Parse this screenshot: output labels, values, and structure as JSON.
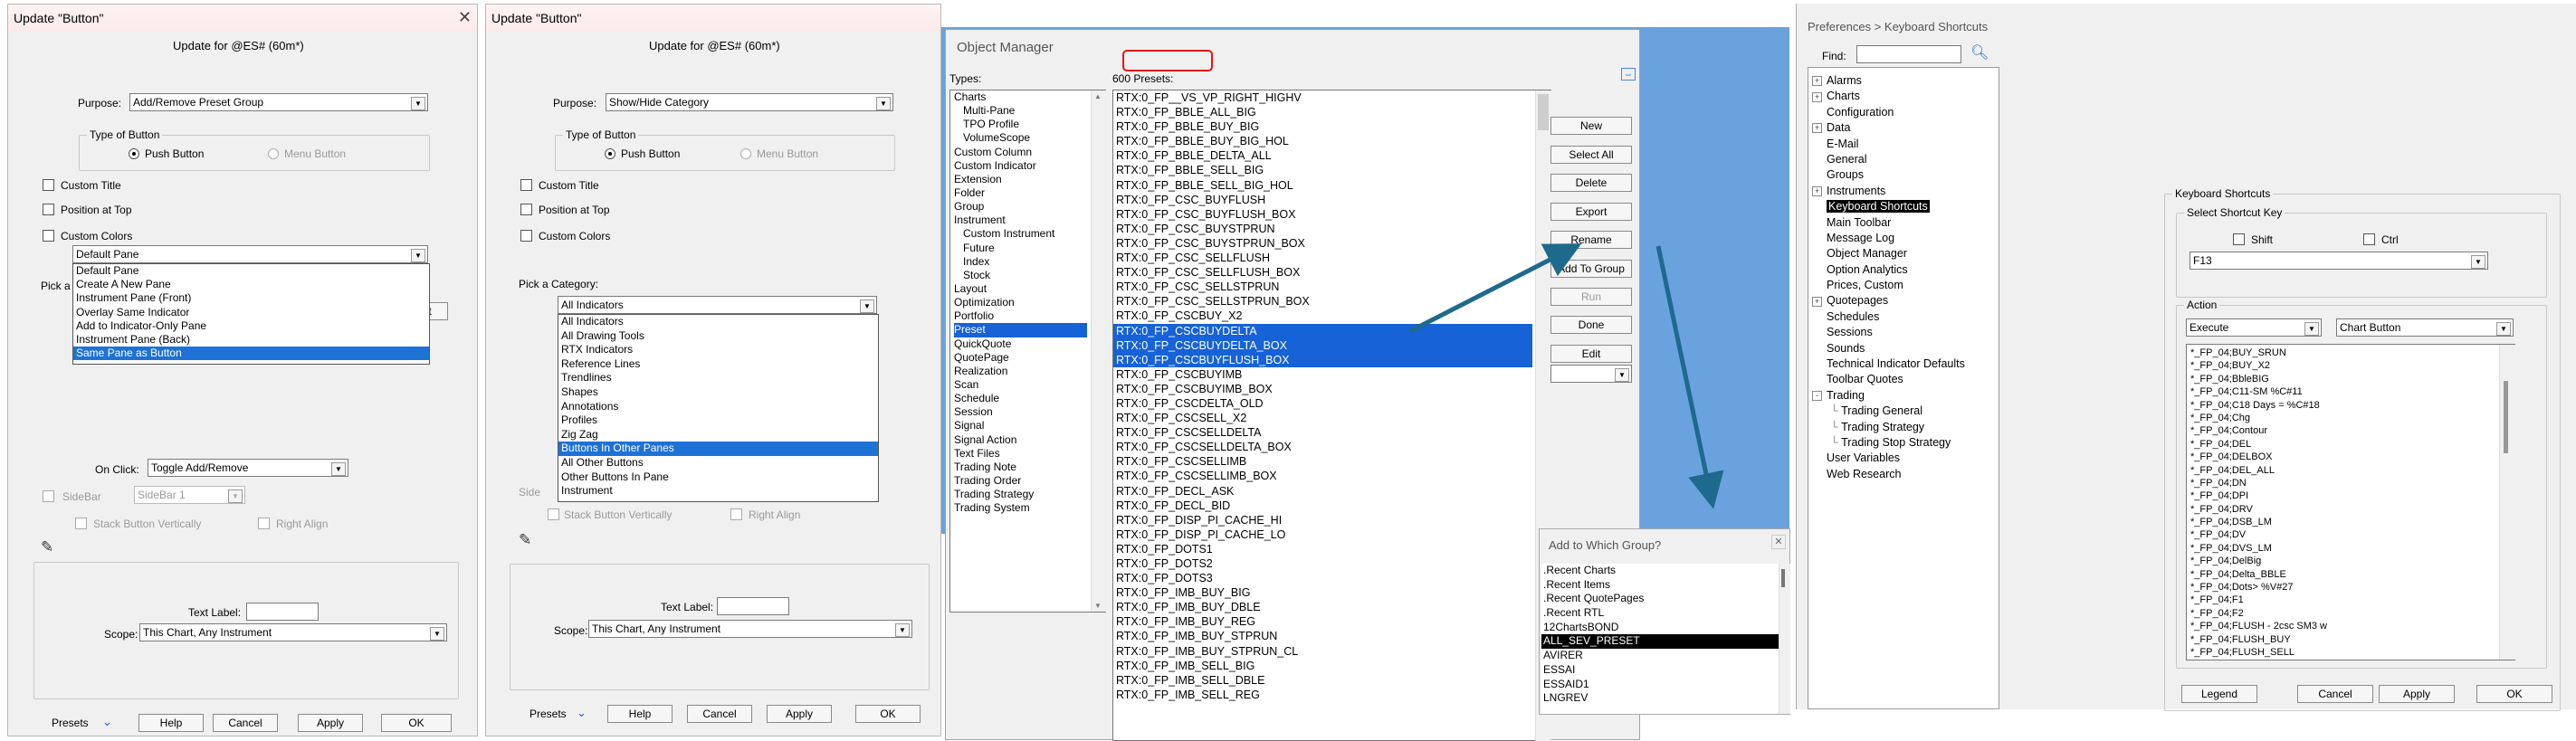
{
  "panel1": {
    "title": "Update \"Button\"",
    "subtitle": "Update  for @ES# (60m*)",
    "purpose_label": "Purpose:",
    "purpose_value": "Add/Remove Preset Group",
    "type_group_label": "Type of Button",
    "push_button": "Push Button",
    "menu_button": "Menu Button",
    "custom_title": "Custom Title",
    "position_top": "Position at Top",
    "custom_colors": "Custom Colors",
    "pane_combo_value": "Default Pane",
    "pick_a_partial": "Pick a",
    "pane_options": [
      "Default Pane",
      "Create A New Pane",
      "Instrument Pane (Front)",
      "Overlay Same Indicator",
      "Add to Indicator-Only Pane",
      "Instrument Pane (Back)",
      "Same Pane as Button"
    ],
    "pane_selected_index": 6,
    "on_click_label": "On Click:",
    "on_click_value": "Toggle Add/Remove",
    "sidebar_label": "SideBar",
    "sidebar_value": "SideBar 1",
    "stack_vertically": "Stack Button Vertically",
    "right_align": "Right Align",
    "text_label": "Text Label:",
    "scope_label": "Scope:",
    "scope_value": "This Chart, Any Instrument",
    "presets": "Presets",
    "help": "Help",
    "cancel": "Cancel",
    "apply": "Apply",
    "ok": "OK"
  },
  "panel2": {
    "title": "Update \"Button\"",
    "subtitle": "Update  for @ES# (60m*)",
    "purpose_label": "Purpose:",
    "purpose_value": "Show/Hide Category",
    "type_group_label": "Type of Button",
    "push_button": "Push Button",
    "menu_button": "Menu Button",
    "custom_title": "Custom Title",
    "position_top": "Position at Top",
    "custom_colors": "Custom Colors",
    "pick_category": "Pick a Category:",
    "category_value": "All Indicators",
    "category_options": [
      "All Indicators",
      "All Drawing Tools",
      "RTX Indicators",
      "Reference Lines",
      "Trendlines",
      "Shapes",
      "Annotations",
      "Profiles",
      "Zig Zag",
      "Buttons In Other Panes",
      "All Other Buttons",
      "Other Buttons In Pane",
      "Instrument"
    ],
    "category_selected_index": 9,
    "side_partial": "Side",
    "stack_vertically": "Stack Button Vertically",
    "right_align": "Right Align",
    "text_label": "Text Label:",
    "scope_label": "Scope:",
    "scope_value": "This Chart, Any Instrument",
    "presets": "Presets",
    "help": "Help",
    "cancel": "Cancel",
    "apply": "Apply",
    "ok": "OK"
  },
  "object_manager": {
    "title": "Object Manager",
    "types_label": "Types:",
    "presets_count": "600 Presets:",
    "types": [
      "Charts",
      "  Multi-Pane",
      "  TPO Profile",
      "  VolumeScope",
      "Custom Column",
      "Custom Indicator",
      "Extension",
      "Folder",
      "Group",
      "Instrument",
      "  Custom Instrument",
      "  Future",
      "  Index",
      "  Stock",
      "Layout",
      "Optimization",
      "Portfolio",
      "Preset",
      "QuickQuote",
      "QuotePage",
      "Realization",
      "Scan",
      "Schedule",
      "Session",
      "Signal",
      "Signal Action",
      "Text Files",
      "Trading Note",
      "Trading Order",
      "Trading Strategy",
      "Trading System"
    ],
    "types_selected_index": 17,
    "presets": [
      "RTX:0_FP__VS_VP_RIGHT_HIGHV",
      "RTX:0_FP_BBLE_ALL_BIG",
      "RTX:0_FP_BBLE_BUY_BIG",
      "RTX:0_FP_BBLE_BUY_BIG_HOL",
      "RTX:0_FP_BBLE_DELTA_ALL",
      "RTX:0_FP_BBLE_SELL_BIG",
      "RTX:0_FP_BBLE_SELL_BIG_HOL",
      "RTX:0_FP_CSC_BUYFLUSH",
      "RTX:0_FP_CSC_BUYFLUSH_BOX",
      "RTX:0_FP_CSC_BUYSTPRUN",
      "RTX:0_FP_CSC_BUYSTPRUN_BOX",
      "RTX:0_FP_CSC_SELLFLUSH",
      "RTX:0_FP_CSC_SELLFLUSH_BOX",
      "RTX:0_FP_CSC_SELLSTPRUN",
      "RTX:0_FP_CSC_SELLSTPRUN_BOX",
      "RTX:0_FP_CSCBUY_X2",
      "RTX:0_FP_CSCBUYDELTA",
      "RTX:0_FP_CSCBUYDELTA_BOX",
      "RTX:0_FP_CSCBUYFLUSH_BOX",
      "RTX:0_FP_CSCBUYIMB",
      "RTX:0_FP_CSCBUYIMB_BOX",
      "RTX:0_FP_CSCDELTA_OLD",
      "RTX:0_FP_CSCSELL_X2",
      "RTX:0_FP_CSCSELLDELTA",
      "RTX:0_FP_CSCSELLDELTA_BOX",
      "RTX:0_FP_CSCSELLIMB",
      "RTX:0_FP_CSCSELLIMB_BOX",
      "RTX:0_FP_DECL_ASK",
      "RTX:0_FP_DECL_BID",
      "RTX:0_FP_DISP_PI_CACHE_HI",
      "RTX:0_FP_DISP_PI_CACHE_LO",
      "RTX:0_FP_DOTS1",
      "RTX:0_FP_DOTS2",
      "RTX:0_FP_DOTS3",
      "RTX:0_FP_IMB_BUY_BIG",
      "RTX:0_FP_IMB_BUY_DBLE",
      "RTX:0_FP_IMB_BUY_REG",
      "RTX:0_FP_IMB_BUY_STPRUN",
      "RTX:0_FP_IMB_BUY_STPRUN_CL",
      "RTX:0_FP_IMB_SELL_BIG",
      "RTX:0_FP_IMB_SELL_DBLE",
      "RTX:0_FP_IMB_SELL_REG"
    ],
    "presets_selected": [
      16,
      17,
      18
    ],
    "buttons": [
      "New",
      "Select All",
      "Delete",
      "Export",
      "Rename",
      "Add To Group",
      "Run",
      "Done",
      "Edit"
    ],
    "add_group_title": "Add to Which Group?",
    "groups": [
      ".Recent Charts",
      ".Recent Items",
      ".Recent QuotePages",
      ".Recent RTL",
      "12ChartsBOND",
      "ALL_SEV_PRESET",
      "AVIRER",
      "ESSAI",
      "ESSAID1",
      "LNGREV"
    ],
    "groups_selected_index": 5,
    "accent_arrow": "#1e6a8c",
    "blue_bg": "#6aa2de"
  },
  "preferences": {
    "title": "Preferences > Keyboard Shortcuts",
    "find_label": "Find:",
    "tree": [
      {
        "label": "Alarms",
        "exp": "+"
      },
      {
        "label": "Charts",
        "exp": "+"
      },
      {
        "label": "Configuration",
        "exp": ""
      },
      {
        "label": "Data",
        "exp": "+"
      },
      {
        "label": "E-Mail",
        "exp": ""
      },
      {
        "label": "General",
        "exp": ""
      },
      {
        "label": "Groups",
        "exp": ""
      },
      {
        "label": "Instruments",
        "exp": "+"
      },
      {
        "label": "Keyboard Shortcuts",
        "exp": "",
        "sel": true
      },
      {
        "label": "Main Toolbar",
        "exp": ""
      },
      {
        "label": "Message Log",
        "exp": ""
      },
      {
        "label": "Object Manager",
        "exp": ""
      },
      {
        "label": "Option Analytics",
        "exp": ""
      },
      {
        "label": "Prices, Custom",
        "exp": ""
      },
      {
        "label": "Quotepages",
        "exp": "+"
      },
      {
        "label": "Schedules",
        "exp": ""
      },
      {
        "label": "Sessions",
        "exp": ""
      },
      {
        "label": "Sounds",
        "exp": ""
      },
      {
        "label": "Technical Indicator Defaults",
        "exp": ""
      },
      {
        "label": "Toolbar Quotes",
        "exp": ""
      },
      {
        "label": "Trading",
        "exp": "-"
      },
      {
        "label": "Trading General",
        "exp": "",
        "child": true
      },
      {
        "label": "Trading Strategy",
        "exp": "",
        "child": true
      },
      {
        "label": "Trading Stop Strategy",
        "exp": "",
        "child": true
      },
      {
        "label": "User Variables",
        "exp": ""
      },
      {
        "label": "Web Research",
        "exp": ""
      }
    ],
    "ks_group": "Keyboard Shortcuts",
    "select_key_group": "Select Shortcut Key",
    "shift": "Shift",
    "ctrl": "Ctrl",
    "key_value": "F13",
    "action_group": "Action",
    "action_value": "Execute",
    "target_value": "Chart Button",
    "actions": [
      "*_FP_04;BUY_SRUN",
      "*_FP_04;BUY_X2",
      "*_FP_04;BbleBIG",
      "*_FP_04;C11-SM %C#11",
      "*_FP_04;C18 Days = %C#18",
      "*_FP_04;Chg",
      "*_FP_04;Contour",
      "*_FP_04;DEL",
      "*_FP_04;DELBOX",
      "*_FP_04;DEL_ALL",
      "*_FP_04;DN",
      "*_FP_04;DPI",
      "*_FP_04;DRV",
      "*_FP_04;DSB_LM",
      "*_FP_04;DV",
      "*_FP_04;DVS_LM",
      "*_FP_04;DelBig",
      "*_FP_04;Delta_BBLE",
      "*_FP_04;Dots> %V#27",
      "*_FP_04;F1",
      "*_FP_04;F2",
      "*_FP_04;FLUSH - 2csc SM3 w",
      "*_FP_04;FLUSH_BUY",
      "*_FP_04;FLUSH_SELL"
    ],
    "legend": "Legend",
    "cancel": "Cancel",
    "apply": "Apply",
    "ok": "OK"
  }
}
